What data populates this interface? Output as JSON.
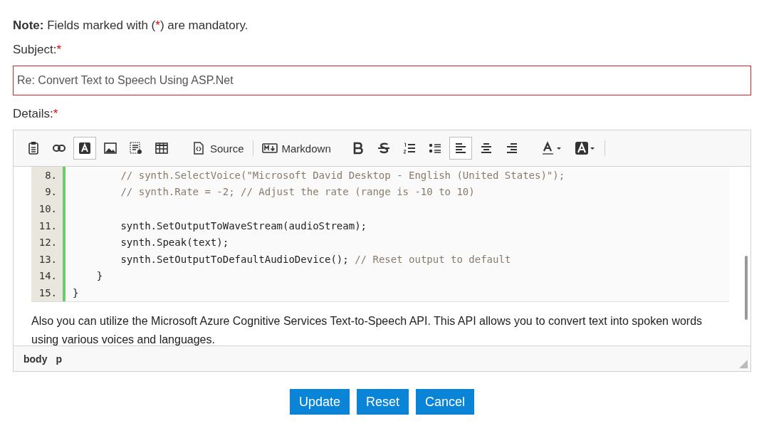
{
  "note": {
    "label": "Note:",
    "text": "Fields marked with (",
    "star": "*",
    "suffix": ") are mandatory."
  },
  "subject": {
    "label": "Subject:",
    "star": "*",
    "value": "Re: Convert Text to Speech Using ASP.Net"
  },
  "details": {
    "label": "Details:",
    "star": "*"
  },
  "toolbar": [
    {
      "kind": "paste",
      "selected": false
    },
    {
      "kind": "link",
      "selected": false
    },
    {
      "kind": "textbox",
      "selected": true
    },
    {
      "kind": "image",
      "selected": false
    },
    {
      "kind": "template",
      "selected": false
    },
    {
      "kind": "table",
      "selected": false
    },
    {
      "kind": "source",
      "label": "Source",
      "selected": false
    },
    {
      "kind": "markdown",
      "label": "Markdown",
      "selected": false
    },
    {
      "kind": "bold",
      "selected": false
    },
    {
      "kind": "strike",
      "selected": false
    },
    {
      "kind": "ordered-list",
      "selected": false
    },
    {
      "kind": "bullet-list",
      "selected": false
    },
    {
      "kind": "align-left",
      "selected": true
    },
    {
      "kind": "align-center",
      "selected": false
    },
    {
      "kind": "align-right",
      "selected": false
    },
    {
      "kind": "text-color",
      "selected": false
    },
    {
      "kind": "background-color",
      "selected": false
    }
  ],
  "code_lines": [
    {
      "number": "8.",
      "parts": [
        {
          "kind": "comment",
          "text": "        // synth.SelectVoice(\"Microsoft David Desktop - English (United States)\");"
        }
      ]
    },
    {
      "number": "9.",
      "parts": [
        {
          "kind": "comment",
          "text": "        // synth.Rate = -2; // Adjust the rate (range is -10 to 10)"
        }
      ]
    },
    {
      "number": "10."
    },
    {
      "number": "11.",
      "parts": [
        {
          "kind": "code",
          "text": "        synth.SetOutputToWaveStream(audioStream);"
        }
      ]
    },
    {
      "number": "12.",
      "parts": [
        {
          "kind": "code",
          "text": "        synth.Speak(text);"
        }
      ]
    },
    {
      "number": "13.",
      "parts": [
        {
          "kind": "code",
          "text": "        synth.SetOutputToDefaultAudioDevice();"
        },
        {
          "kind": "comment",
          "text": " // Reset output to default"
        }
      ]
    },
    {
      "number": "14.",
      "parts": [
        {
          "kind": "code",
          "text": "    }"
        }
      ]
    },
    {
      "number": "15.",
      "parts": [
        {
          "kind": "code",
          "text": "}"
        }
      ]
    }
  ],
  "paragraph": "Also you can utilize the Microsoft Azure Cognitive Services Text-to-Speech API. This API allows you to convert text into spoken words using various voices and languages.",
  "path": [
    "body",
    "p"
  ],
  "buttons": [
    "Update",
    "Reset",
    "Cancel"
  ]
}
